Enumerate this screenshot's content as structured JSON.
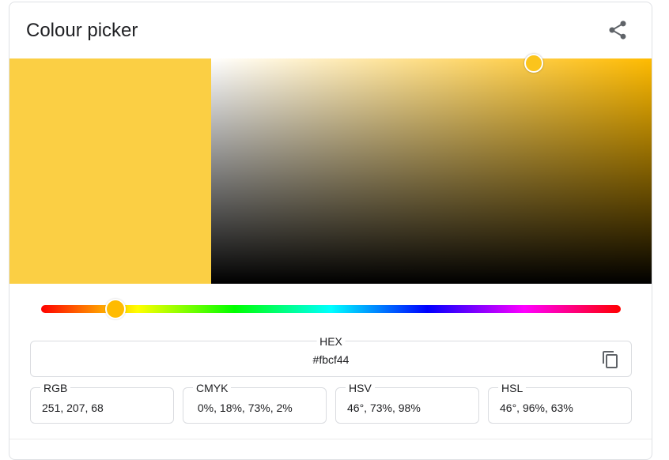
{
  "header": {
    "title": "Colour picker",
    "share_icon": "share-icon"
  },
  "color": {
    "hex_value": "#fbcf44",
    "swatch": "#fbcf44",
    "hue_color": "#ffbb00",
    "handle": "#fbc41c"
  },
  "picker": {
    "hue_degrees": 46,
    "saturation": 0.73,
    "value": 0.98
  },
  "hex": {
    "label": "HEX",
    "value": "#fbcf44",
    "copy_icon": "copy-icon"
  },
  "formats": [
    {
      "label": "RGB",
      "value": "251, 207, 68"
    },
    {
      "label": "CMYK",
      "value": " 0%, 18%, 73%, 2%"
    },
    {
      "label": "HSV",
      "value": "46°, 73%, 98%"
    },
    {
      "label": "HSL",
      "value": "46°, 96%, 63%"
    }
  ]
}
